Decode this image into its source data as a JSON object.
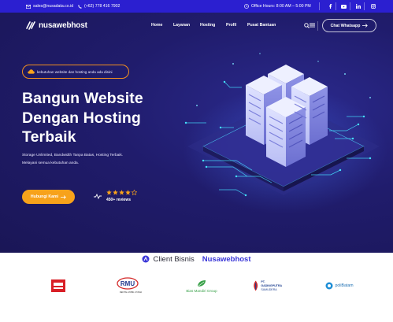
{
  "topbar": {
    "email": "sales@nusadata.co.id",
    "phone": "(+62) 778 416 7902",
    "office_hours": "Office Hours: 8:00 AM – 5:00 PM",
    "socials": [
      "facebook-icon",
      "youtube-icon",
      "linkedin-icon",
      "instagram-icon"
    ]
  },
  "header": {
    "logo_text": "nusawebhost",
    "nav": [
      "Home",
      "Layanan",
      "Hosting",
      "Profil",
      "Pusat Bantuan"
    ],
    "chat_label": "Chat Whatsapp"
  },
  "hero": {
    "badge": "kebutuhan website dan hosting anda ada disini",
    "heading_lines": [
      "Bangun Website",
      "Dengan Hosting",
      "Terbaik"
    ],
    "description_lines": [
      "Storage Unlimited,   Bandwidth Tanpa Batas,   Hosting Terbaik.",
      "Melayani semua kebutuhan anda."
    ],
    "cta_label": "Hubungi Kami",
    "rating": 4,
    "rating_max": 5,
    "reviews": "450+ reviews"
  },
  "clients": {
    "title_part1": "Client Bisnis",
    "title_part2": "Nusawebhost",
    "logos": [
      {
        "name": "client-logo-1",
        "text": ""
      },
      {
        "name": "client-logo-rmu",
        "text": "RMU",
        "subtext": "RENTAL MOBIL UTAMA"
      },
      {
        "name": "client-logo-bias",
        "text": "Bias Mandiri Group"
      },
      {
        "name": "client-logo-gadingputra",
        "text": "PT. GADINGPUTRA",
        "subtext": "SAMUDERA"
      },
      {
        "name": "client-logo-polibatam",
        "text": "poliBatam"
      }
    ]
  },
  "colors": {
    "topbar": "#2b1fd0",
    "hero_bg": "#1e1a62",
    "accent": "#f7a21b",
    "brand_blue": "#3a36d8"
  }
}
